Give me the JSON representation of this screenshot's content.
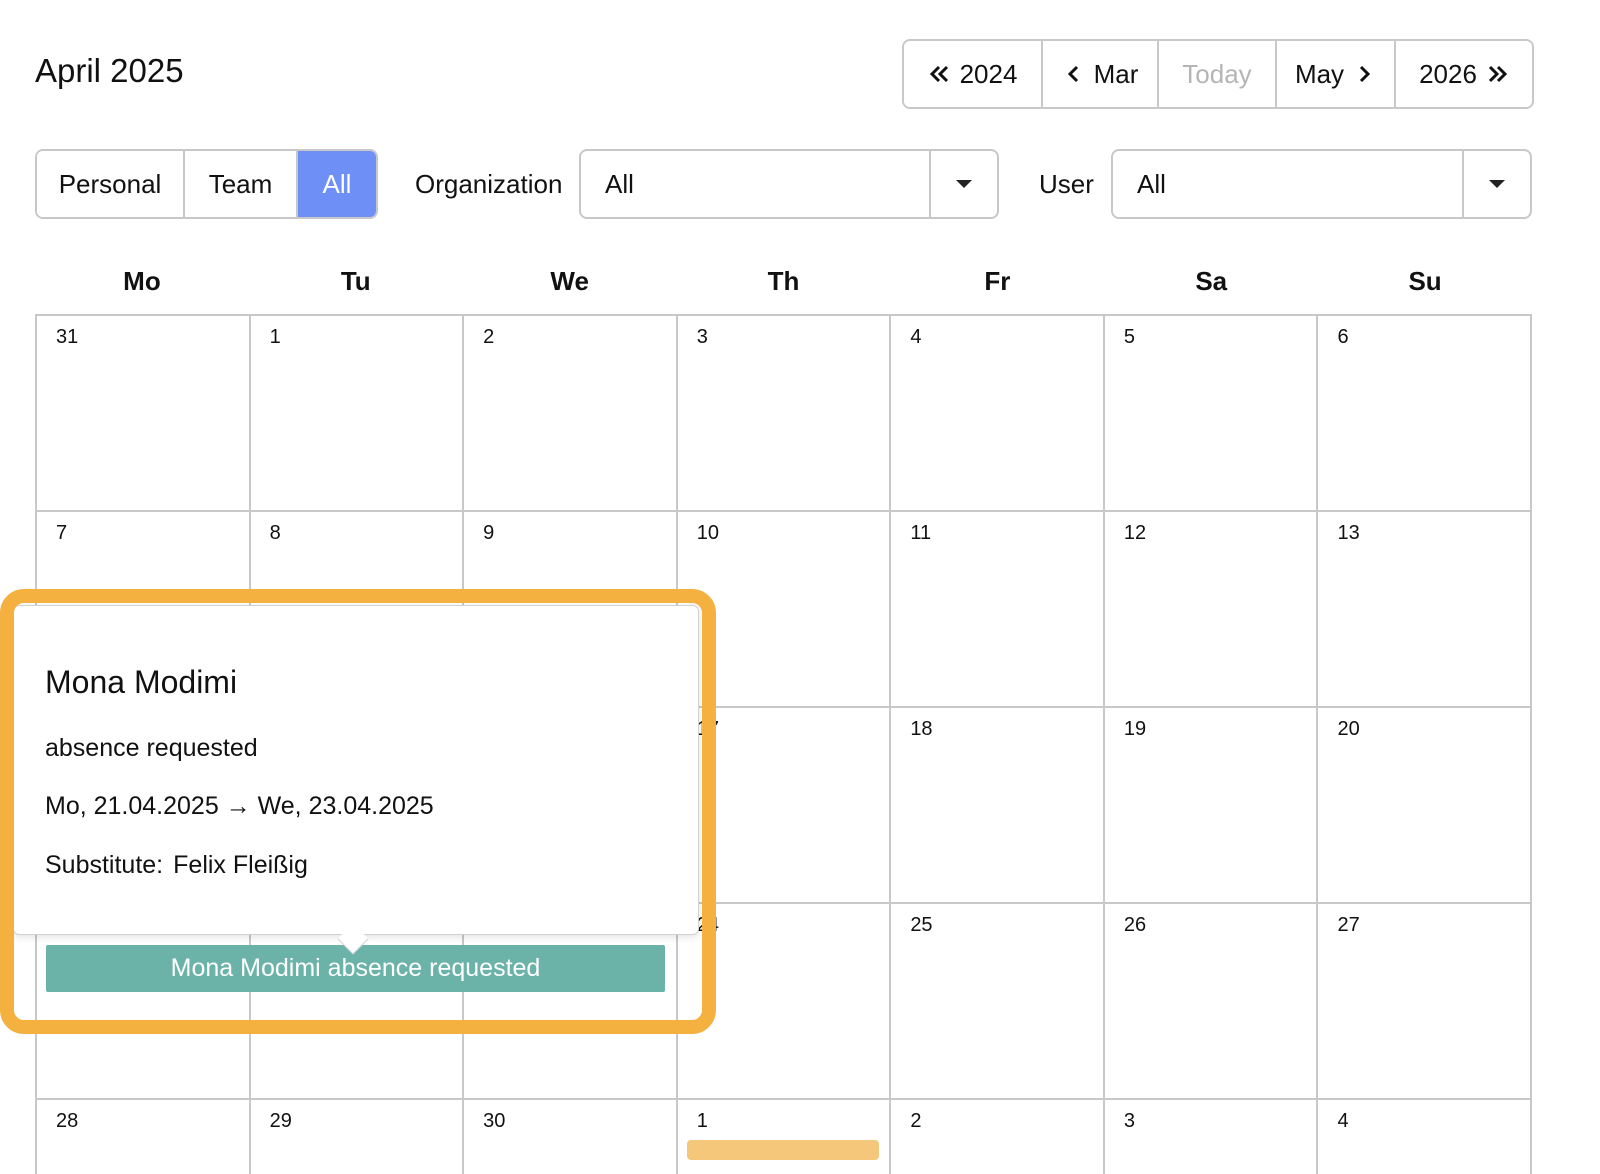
{
  "header": {
    "month_title": "April 2025",
    "nav": {
      "prev_year": "2024",
      "prev_month": "Mar",
      "today": "Today",
      "next_month": "May",
      "next_year": "2026"
    }
  },
  "filters": {
    "view_modes": [
      "Personal",
      "Team",
      "All"
    ],
    "active_view": "All",
    "organization_label": "Organization",
    "organization_value": "All",
    "user_label": "User",
    "user_value": "All"
  },
  "calendar": {
    "weekdays": [
      "Mo",
      "Tu",
      "We",
      "Th",
      "Fr",
      "Sa",
      "Su"
    ],
    "weeks": [
      [
        "31",
        "1",
        "2",
        "3",
        "4",
        "5",
        "6"
      ],
      [
        "7",
        "8",
        "9",
        "10",
        "11",
        "12",
        "13"
      ],
      [
        "",
        "",
        "",
        "17",
        "18",
        "19",
        "20"
      ],
      [
        "",
        "",
        "",
        "24",
        "25",
        "26",
        "27"
      ],
      [
        "28",
        "29",
        "30",
        "1",
        "2",
        "3",
        "4"
      ]
    ],
    "event_bar": "Mona Modimi absence requested"
  },
  "popover": {
    "name": "Mona Modimi",
    "status": "absence requested",
    "dates": "Mo, 21.04.2025 → We, 23.04.2025",
    "substitute_label": "Substitute:",
    "substitute_name": "Felix Fleißig"
  },
  "colors": {
    "accent": "#6e8ff5",
    "event_absence": "#6bb3a8",
    "event_other": "#f4c77a",
    "highlight": "#f4b13f"
  }
}
